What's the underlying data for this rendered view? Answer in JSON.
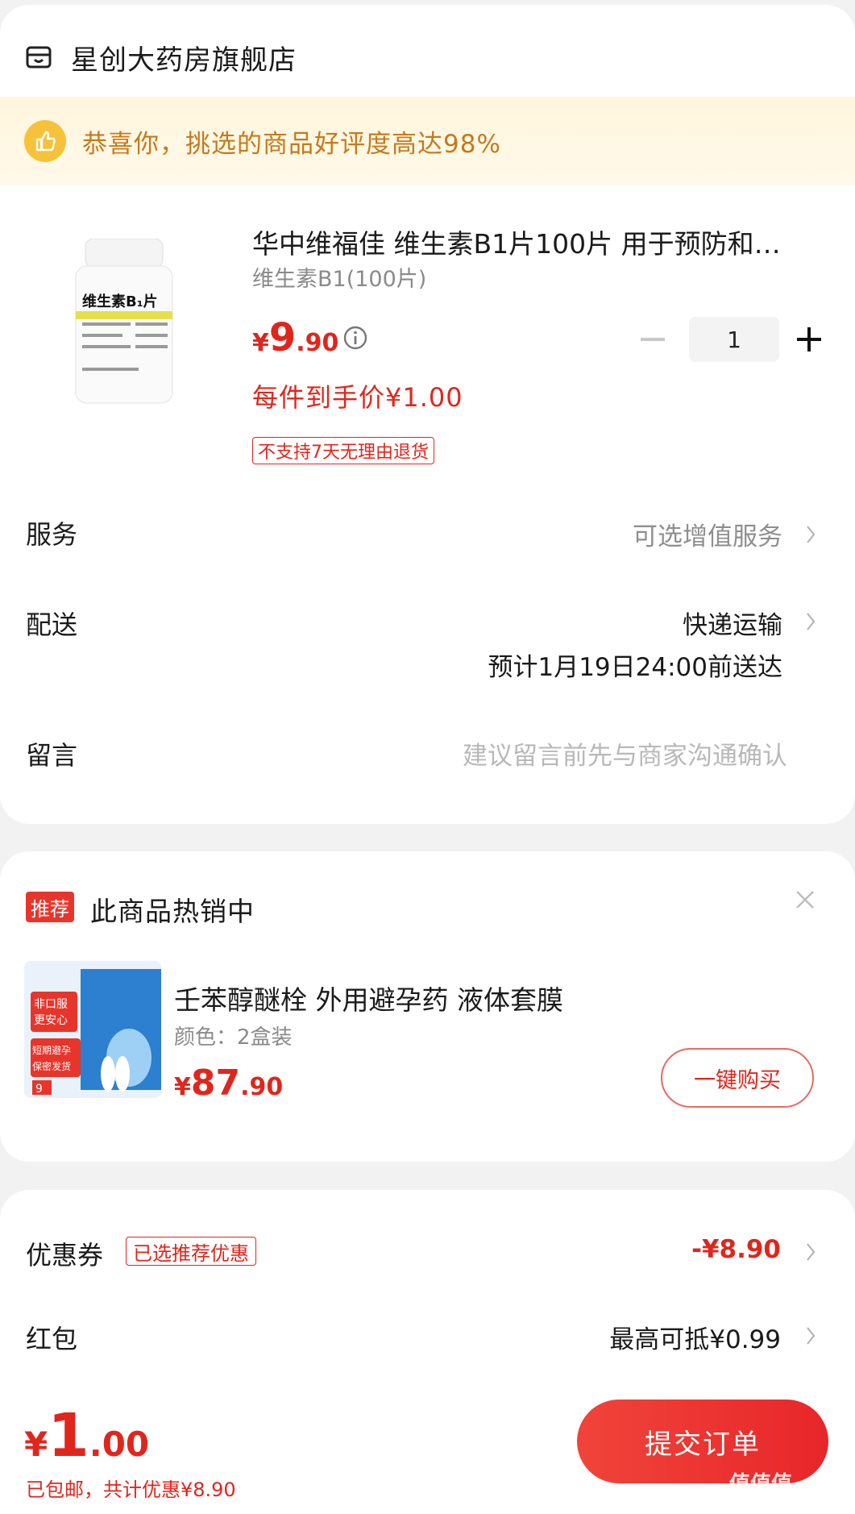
{
  "store": {
    "name": "星创大药房旗舰店"
  },
  "banner": {
    "text": "恭喜你，挑选的商品好评度高达98%"
  },
  "product": {
    "title": "华中维福佳 维生素B1片100片 用于预防和…",
    "spec": "维生素B1(100片)",
    "price_currency": "¥",
    "price_int": "9",
    "price_dec": ".90",
    "quantity": "1",
    "per_item_price": "每件到手价¥1.00",
    "return_policy": "不支持7天无理由退货",
    "image_label": "维生素B₁片"
  },
  "rows": {
    "service_label": "服务",
    "service_value": "可选增值服务",
    "delivery_label": "配送",
    "delivery_value": "快递运输",
    "delivery_eta": "预计1月19日24:00前送达",
    "message_label": "留言",
    "message_placeholder": "建议留言前先与商家沟通确认"
  },
  "recommend": {
    "tag": "推荐",
    "title": "此商品热销中",
    "name": "壬苯醇醚栓 外用避孕药 液体套膜",
    "spec": "颜色：2盒装",
    "price_currency": "¥",
    "price_int": "87",
    "price_dec": ".90",
    "buy_label": "一键购买",
    "img_lines": [
      "非口服",
      "更安心",
      "短期避孕",
      "保密发货",
      "9"
    ]
  },
  "checkout": {
    "coupon_label": "优惠券",
    "coupon_tag": "已选推荐优惠",
    "coupon_value": "-¥8.90",
    "redpacket_label": "红包",
    "redpacket_value": "最高可抵¥0.99",
    "total_currency": "¥",
    "total_int": "1",
    "total_dec": ".00",
    "total_note": "已包邮，共计优惠¥8.90",
    "submit_label": "提交订单"
  },
  "watermark": {
    "text": "值值值"
  },
  "colors": {
    "accent": "#e0261c",
    "banner_bg": "#fff6dc",
    "banner_text": "#c57a1c"
  }
}
